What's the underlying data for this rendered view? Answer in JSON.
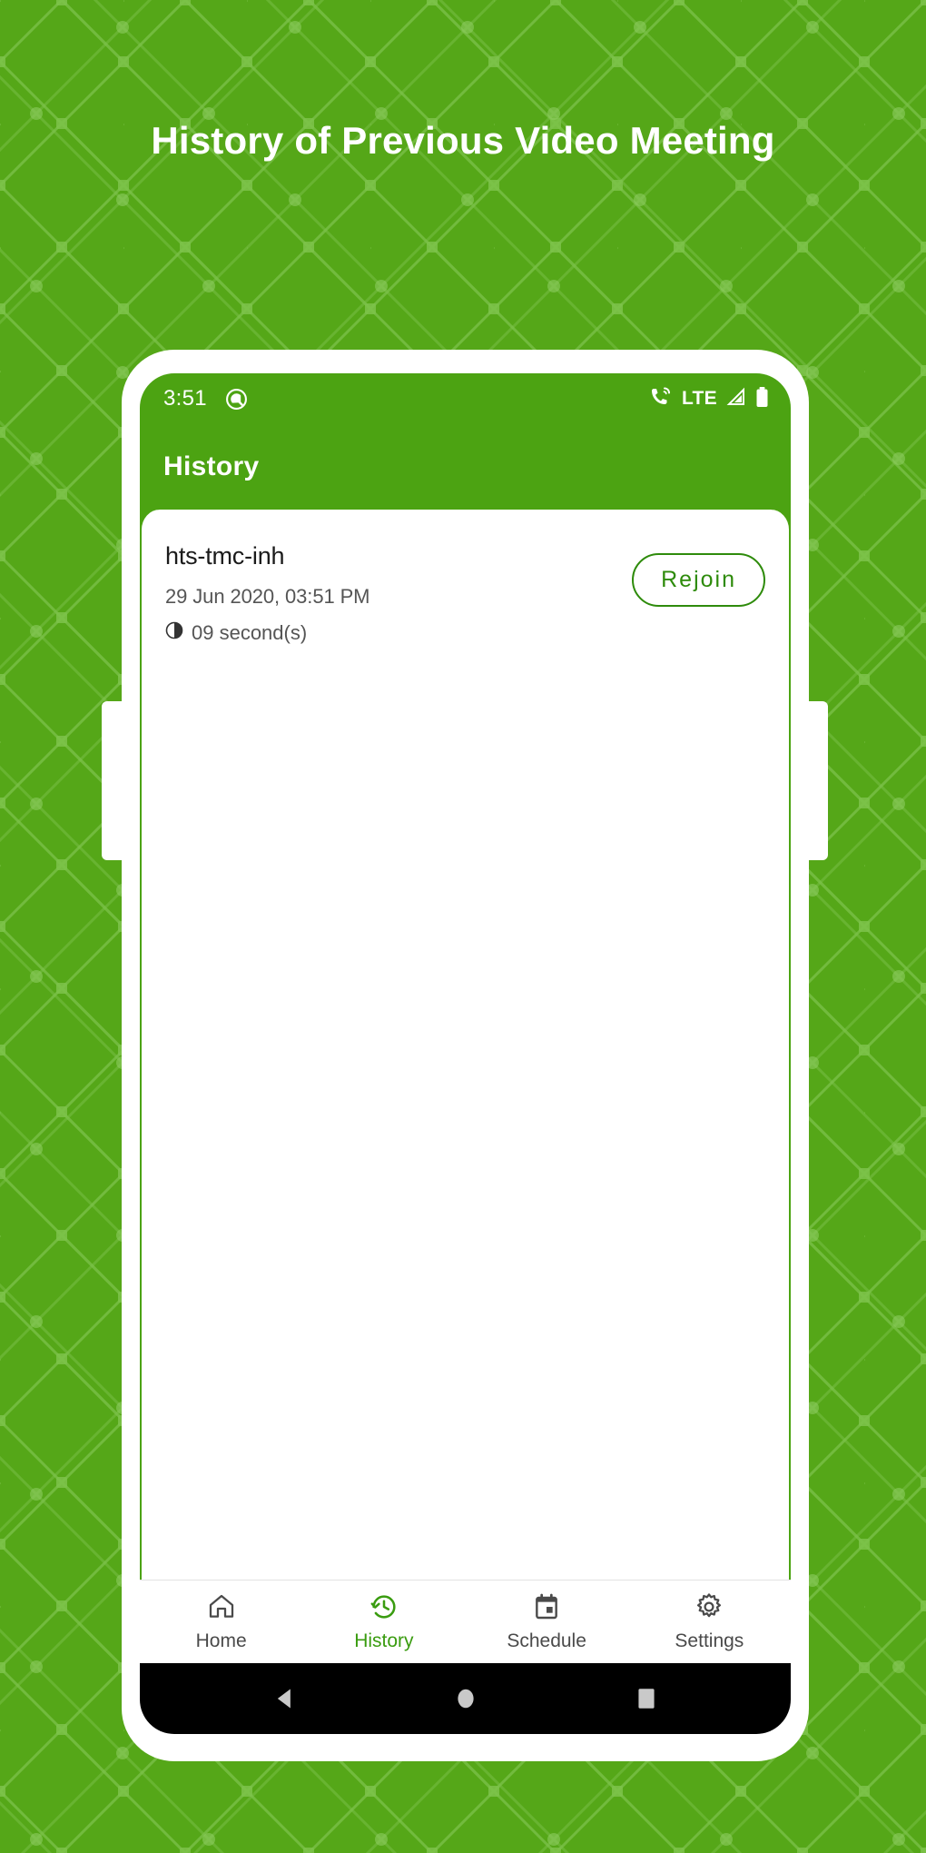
{
  "page": {
    "heading": "History of Previous Video Meeting",
    "background_color": "#55a718",
    "accent_color": "#4ca312",
    "button_green": "#2e8b0b"
  },
  "status_bar": {
    "time": "3:51",
    "android_q_icon": "android-q-icon",
    "call_icon": "call-forward-icon",
    "network_label": "LTE",
    "signal_icon": "signal-bars-icon",
    "battery_icon": "battery-full-icon"
  },
  "app_bar": {
    "title": "History"
  },
  "meetings": [
    {
      "title": "hts-tmc-inh",
      "date": "29 Jun 2020, 03:51 PM",
      "duration_icon": "clock-icon",
      "duration": "09 second(s)",
      "action_label": "Rejoin"
    }
  ],
  "bottom_nav": {
    "active_index": 1,
    "items": [
      {
        "label": "Home",
        "icon": "home-icon"
      },
      {
        "label": "History",
        "icon": "history-clock-icon"
      },
      {
        "label": "Schedule",
        "icon": "calendar-icon"
      },
      {
        "label": "Settings",
        "icon": "gear-icon"
      }
    ]
  },
  "android_nav": {
    "back": "back-triangle-icon",
    "home": "home-circle-icon",
    "recents": "recents-square-icon"
  }
}
